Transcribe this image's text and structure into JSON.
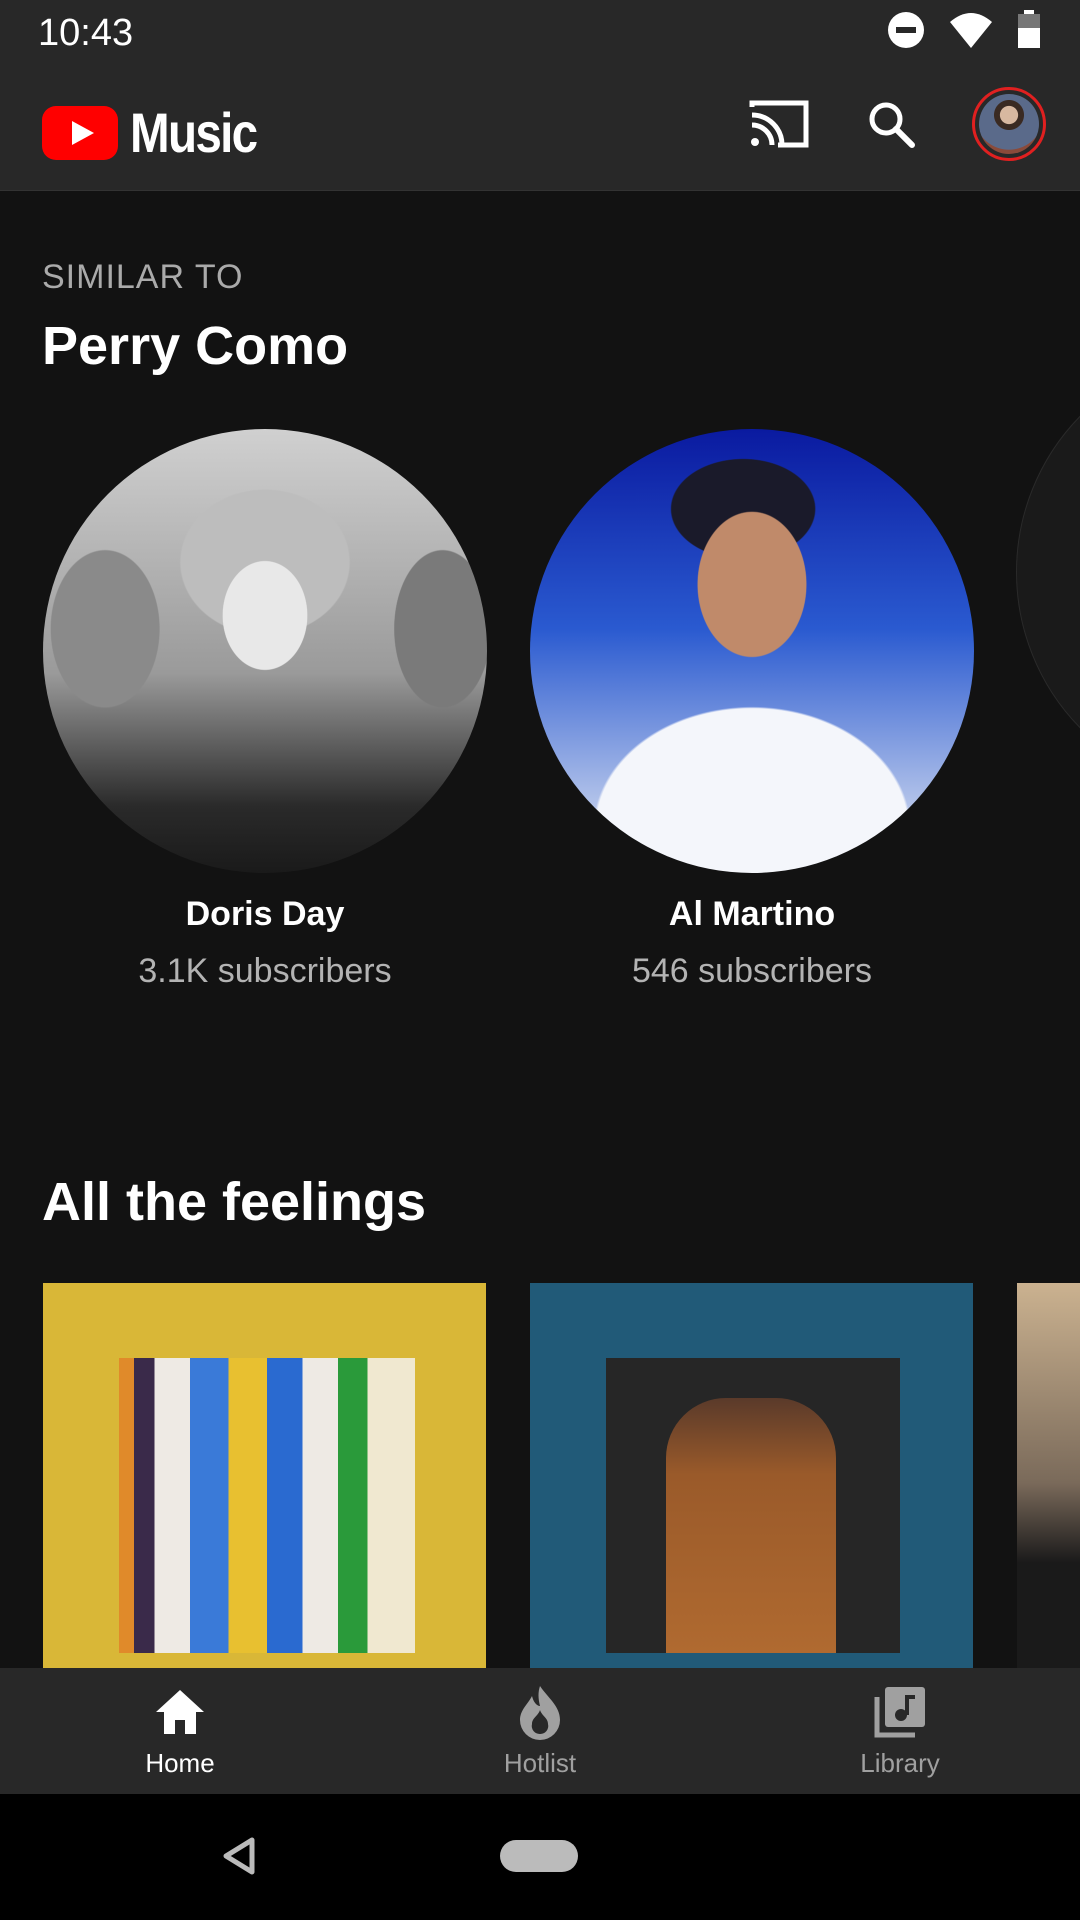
{
  "status_bar": {
    "time": "10:43",
    "icons": [
      "do-not-disturb-icon",
      "wifi-icon",
      "battery-icon"
    ]
  },
  "app_bar": {
    "logo_text": "Music",
    "brand_color": "#ff0000",
    "actions": [
      "cast-icon",
      "search-icon",
      "account-avatar"
    ]
  },
  "similar_section": {
    "eyebrow": "SIMILAR TO",
    "title": "Perry Como",
    "artists": [
      {
        "name": "Doris Day",
        "subscribers": "3.1K subscribers"
      },
      {
        "name": "Al Martino",
        "subscribers": "546 subscribers"
      }
    ]
  },
  "feelings_section": {
    "title": "All the feelings",
    "tiles": [
      "playlist-tile-yellow-doors",
      "playlist-tile-blue-jacket",
      "playlist-tile-partial"
    ]
  },
  "bottom_nav": {
    "items": [
      {
        "label": "Home",
        "icon": "home-icon",
        "active": true
      },
      {
        "label": "Hotlist",
        "icon": "fire-icon",
        "active": false
      },
      {
        "label": "Library",
        "icon": "library-music-icon",
        "active": false
      }
    ]
  }
}
